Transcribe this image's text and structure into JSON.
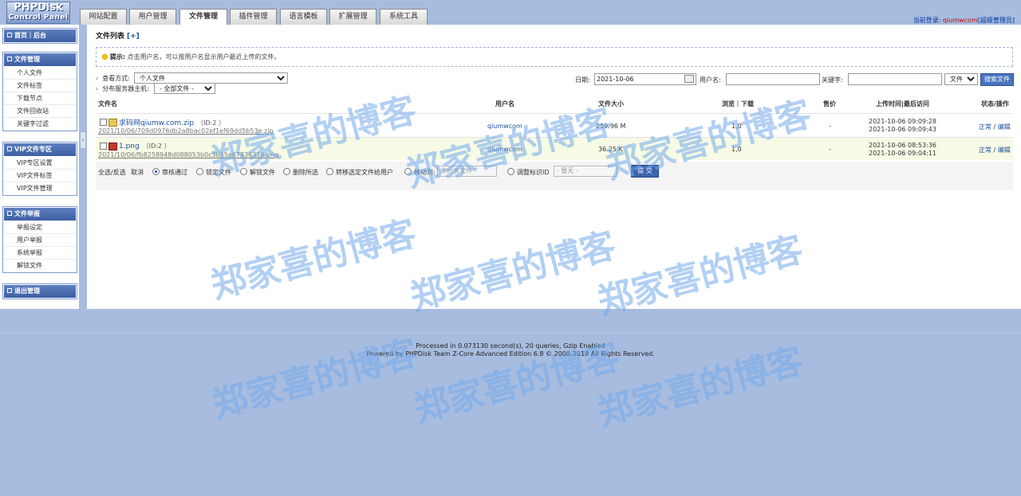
{
  "logo": {
    "line1": "PHPDisk",
    "line2": "Control Panel"
  },
  "tabs": [
    "网站配置",
    "用户管理",
    "文件管理",
    "插件管理",
    "语言模板",
    "扩展管理",
    "系统工具"
  ],
  "login": {
    "prefix": "当前登录: ",
    "user": "qiumwcom",
    "role": "[超级管理员]"
  },
  "sidebar": {
    "home": "首页｜后台",
    "file_admin": {
      "title": "文件管理",
      "items": [
        "个人文件",
        "文件标签",
        "下载节点",
        "文件回收站",
        "关键字过滤"
      ]
    },
    "vip": {
      "title": "VIP文件专区",
      "items": [
        "VIP专区设置",
        "VIP文件标签",
        "VIP文件管理"
      ]
    },
    "report": {
      "title": "文件举报",
      "items": [
        "举报设定",
        "用户举报",
        "系统举报",
        "解锁文件"
      ]
    },
    "logout": "退出管理"
  },
  "main": {
    "title": "文件列表",
    "title_plus": "[+]",
    "tip_label": "提示:",
    "tip_text": " 点击用户名，可以按用户名显示用户最近上传的文件。",
    "view_label": "查看方式:",
    "view_value": "个人文件",
    "server_label": "分布服务器主机:",
    "server_value": "- 全部文件 -",
    "date_label": "日期:",
    "date_value": "2021-10-06",
    "username_label": "用户名:",
    "keyword_label": "关键字:",
    "search_type": "文件名",
    "search_button": "搜索文件",
    "headers": {
      "name": "文件名",
      "user": "用户名",
      "size": "文件大小",
      "views": "浏览｜下载",
      "price": "售价",
      "time": "上传时间|最后访问",
      "status": "状态/操作"
    },
    "files": [
      {
        "name": "求码网qiumw.com.zip",
        "id": "（ID:2 ）",
        "path": "2021/10/06/709d0976db2a8bac02ef1ef69dd5b53e.zip",
        "user": "qiumwcom",
        "size": "259.96 M",
        "views": "1,0",
        "price": "-",
        "upload": "2021-10-06 09:09:28",
        "last": "2021-10-06 09:09:43",
        "status": "正常",
        "sep": " / ",
        "edit": "编辑",
        "icon": "zip-file-icon"
      },
      {
        "name": "1.png",
        "id": "（ID:2 ）",
        "path": "2021/10/06/fb8258948d088053b0c3b35e67836316.png",
        "user": "qiumwcom",
        "size": "36.25 K",
        "views": "1,0",
        "price": "-",
        "upload": "2021-10-06 08:53:36",
        "last": "2021-10-06 09:04:11",
        "status": "正常",
        "sep": " / ",
        "edit": "编辑",
        "icon": "image-file-icon"
      }
    ],
    "actions": {
      "select_all": "全选/反选",
      "cancel": "取消",
      "approve": "审核通过",
      "lock": "锁定文件",
      "unlock": "解锁文件",
      "delete": "删除所选",
      "transfer": "转移选定文件给用户",
      "move_to": "移动到:",
      "move_select": "未分类文件",
      "adjust_id": "调整标识ID",
      "adjust_select": "- 暂无 -",
      "submit": "提 交"
    }
  },
  "footer": {
    "line1": "Processed in 0.073130 second(s), 20 queries, Gzip Enabled",
    "line2": "Powered by PHPDisk Team Z-Core Advanced Edition 6.8 © 2008-2018 All Rights Reserved."
  },
  "watermark": "郑家喜的博客"
}
